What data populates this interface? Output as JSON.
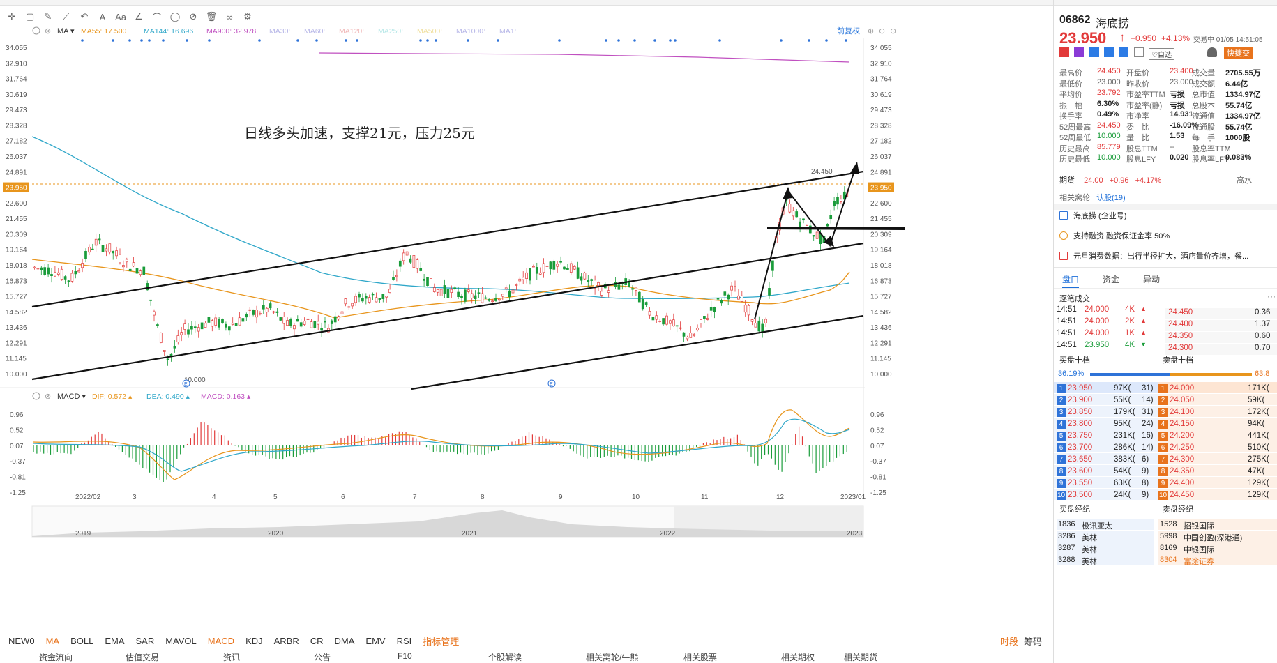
{
  "toolbar": {
    "icons": [
      "crosshair-icon",
      "rect-icon",
      "brush-icon",
      "trend-icon",
      "back-icon",
      "text-icon",
      "font-icon",
      "angle-icon",
      "arc-icon",
      "circle-icon",
      "ban-icon",
      "trash-icon",
      "link-icon",
      "gear-icon"
    ]
  },
  "ma_legend": {
    "label": "MA",
    "items": [
      {
        "name": "MA55:",
        "value": "17.500",
        "color": "#e8951c"
      },
      {
        "name": "MA144:",
        "value": "16.696",
        "color": "#2fa7c9"
      },
      {
        "name": "MA900:",
        "value": "32.978",
        "color": "#c050c0"
      },
      {
        "name": "MA30:",
        "value": "",
        "color": "#b8b8e8"
      },
      {
        "name": "MA60:",
        "value": "",
        "color": "#b8b8e8"
      },
      {
        "name": "MA120:",
        "value": "",
        "color": "#f0b8b8"
      },
      {
        "name": "MA250:",
        "value": "",
        "color": "#b8e8e8"
      },
      {
        "name": "MA500:",
        "value": "",
        "color": "#f0e0a0"
      },
      {
        "name": "MA1000:",
        "value": "",
        "color": "#b8b8e8"
      },
      {
        "name": "MA1:",
        "value": "",
        "color": "#b8b8e8"
      }
    ],
    "adjust": "前复权"
  },
  "macd_legend": {
    "label": "MACD",
    "items": [
      {
        "name": "DIF:",
        "value": "0.572",
        "color": "#e8951c"
      },
      {
        "name": "DEA:",
        "value": "0.490",
        "color": "#2fa7c9"
      },
      {
        "name": "MACD:",
        "value": "0.163",
        "color": "#c050c0"
      }
    ]
  },
  "annotation": "日线多头加速，支撑21元，压力25元",
  "high_label": "24.450",
  "low_label": "10.000",
  "event_marker": "E",
  "price_ticks": [
    "34.055",
    "32.910",
    "31.764",
    "30.619",
    "29.473",
    "28.328",
    "27.182",
    "26.037",
    "24.891",
    "23.950",
    "22.600",
    "21.455",
    "20.309",
    "19.164",
    "18.018",
    "16.873",
    "15.727",
    "14.582",
    "13.436",
    "12.291",
    "11.145",
    "10.000"
  ],
  "macd_ticks": [
    "0.96",
    "0.52",
    "0.07",
    "-0.37",
    "-0.81",
    "-1.25"
  ],
  "month_labels": [
    "2022/02",
    "3",
    "4",
    "5",
    "6",
    "7",
    "8",
    "9",
    "10",
    "11",
    "12",
    "2023/01"
  ],
  "overview_years": [
    "2019",
    "2020",
    "2021",
    "2022",
    "2023"
  ],
  "indicator_tabs": [
    "NEW0",
    "MA",
    "BOLL",
    "EMA",
    "SAR",
    "MAVOL",
    "MACD",
    "KDJ",
    "ARBR",
    "CR",
    "DMA",
    "EMV",
    "RSI",
    "指标管理"
  ],
  "indicator_active": [
    "MA",
    "MACD",
    "指标管理"
  ],
  "indicator_right": [
    "时段",
    "筹码"
  ],
  "bottom_bar": [
    "资金流向",
    "估值交易",
    "资讯",
    "公告",
    "F10",
    "个股解读",
    "相关窝轮/牛熊",
    "相关股票",
    "相关期权",
    "相关期货"
  ],
  "stock": {
    "code": "06862",
    "name": "海底捞",
    "price": "23.950",
    "arrow": "↑",
    "change": "+0.950",
    "pct": "+4.13%",
    "status": "交易中 01/05 14:51:05",
    "add_watch": "自选",
    "quick_trade": "快捷交"
  },
  "stats": [
    [
      {
        "k": "最高价",
        "v": "24.450",
        "c": "red"
      },
      {
        "k": "开盘价",
        "v": "23.400",
        "c": "red"
      },
      {
        "k": "成交量",
        "v": "2705.55万",
        "c": "b"
      }
    ],
    [
      {
        "k": "最低价",
        "v": "23.000",
        "c": "grey"
      },
      {
        "k": "昨收价",
        "v": "23.000",
        "c": "grey"
      },
      {
        "k": "成交额",
        "v": "6.44亿",
        "c": "b"
      }
    ],
    [
      {
        "k": "平均价",
        "v": "23.792",
        "c": "red"
      },
      {
        "k": "市盈率TTM",
        "v": "亏损",
        "c": "b"
      },
      {
        "k": "总市值",
        "v": "1334.97亿",
        "c": "b"
      }
    ],
    [
      {
        "k": "振　幅",
        "v": "6.30%",
        "c": "b"
      },
      {
        "k": "市盈率(静)",
        "v": "亏损",
        "c": "b"
      },
      {
        "k": "总股本",
        "v": "55.74亿",
        "c": "b"
      }
    ],
    [
      {
        "k": "换手率",
        "v": "0.49%",
        "c": "b"
      },
      {
        "k": "市净率",
        "v": "14.931",
        "c": "b"
      },
      {
        "k": "流通值",
        "v": "1334.97亿",
        "c": "b"
      }
    ],
    [
      {
        "k": "52周最高",
        "v": "24.450",
        "c": "red"
      },
      {
        "k": "委　比",
        "v": "-16.09%",
        "c": "b"
      },
      {
        "k": "流通股",
        "v": "55.74亿",
        "c": "b"
      }
    ],
    [
      {
        "k": "52周最低",
        "v": "10.000",
        "c": "green"
      },
      {
        "k": "量　比",
        "v": "1.53",
        "c": "b"
      },
      {
        "k": "每　手",
        "v": "1000股",
        "c": "b"
      }
    ],
    [
      {
        "k": "历史最高",
        "v": "85.779",
        "c": "red"
      },
      {
        "k": "股息TTM",
        "v": "--",
        "c": "grey"
      },
      {
        "k": "股息率TTM",
        "v": "--",
        "c": "grey"
      }
    ],
    [
      {
        "k": "历史最低",
        "v": "10.000",
        "c": "green"
      },
      {
        "k": "股息LFY",
        "v": "0.020",
        "c": "b"
      },
      {
        "k": "股息率LFY",
        "v": "0.083%",
        "c": "b"
      }
    ]
  ],
  "futures": {
    "label": "期货",
    "price": "24.00",
    "change": "+0.96",
    "pct": "+4.17%",
    "extra": "高水"
  },
  "related": {
    "label": "相关窝轮",
    "link": "认股(19)"
  },
  "news": [
    {
      "icon": "building-icon",
      "text": "海底捞 (企业号)"
    },
    {
      "icon": "coin-icon",
      "text": "支持融资 融资保证金率 50%"
    },
    {
      "icon": "doc-icon",
      "text": "元旦消费数据：出行半径扩大，酒店量价齐增，餐..."
    }
  ],
  "tabs": [
    "盘口",
    "资金",
    "异动"
  ],
  "tick_title": "逐笔成交",
  "ticks": [
    {
      "time": "14:51",
      "price": "24.000",
      "vol": "4K",
      "dir": "up"
    },
    {
      "time": "14:51",
      "price": "24.000",
      "vol": "2K",
      "dir": "up"
    },
    {
      "time": "14:51",
      "price": "24.000",
      "vol": "1K",
      "dir": "up"
    },
    {
      "time": "14:51",
      "price": "23.950",
      "vol": "4K",
      "dir": "down"
    }
  ],
  "depth_side": [
    {
      "price": "24.450",
      "vol": "0.36"
    },
    {
      "price": "24.400",
      "vol": "1.37"
    },
    {
      "price": "24.350",
      "vol": "0.60"
    },
    {
      "price": "24.300",
      "vol": "0.70"
    }
  ],
  "orderbook_titles": [
    "买盘十档",
    "卖盘十档"
  ],
  "ratio": {
    "bid": "36.19%",
    "ask": "63.8"
  },
  "bids": [
    {
      "i": "1",
      "p": "23.950",
      "v": "97K(",
      "n": "31)"
    },
    {
      "i": "2",
      "p": "23.900",
      "v": "55K(",
      "n": "14)"
    },
    {
      "i": "3",
      "p": "23.850",
      "v": "179K(",
      "n": "31)"
    },
    {
      "i": "4",
      "p": "23.800",
      "v": "95K(",
      "n": "24)"
    },
    {
      "i": "5",
      "p": "23.750",
      "v": "231K(",
      "n": "16)"
    },
    {
      "i": "6",
      "p": "23.700",
      "v": "286K(",
      "n": "14)"
    },
    {
      "i": "7",
      "p": "23.650",
      "v": "383K(",
      "n": "6)"
    },
    {
      "i": "8",
      "p": "23.600",
      "v": "54K(",
      "n": "9)"
    },
    {
      "i": "9",
      "p": "23.550",
      "v": "63K(",
      "n": "8)"
    },
    {
      "i": "10",
      "p": "23.500",
      "v": "24K(",
      "n": "9)"
    }
  ],
  "asks": [
    {
      "i": "1",
      "p": "24.000",
      "v": "171K("
    },
    {
      "i": "2",
      "p": "24.050",
      "v": "59K("
    },
    {
      "i": "3",
      "p": "24.100",
      "v": "172K("
    },
    {
      "i": "4",
      "p": "24.150",
      "v": "94K("
    },
    {
      "i": "5",
      "p": "24.200",
      "v": "441K("
    },
    {
      "i": "6",
      "p": "24.250",
      "v": "510K("
    },
    {
      "i": "7",
      "p": "24.300",
      "v": "275K("
    },
    {
      "i": "8",
      "p": "24.350",
      "v": "47K("
    },
    {
      "i": "9",
      "p": "24.400",
      "v": "129K("
    },
    {
      "i": "10",
      "p": "24.450",
      "v": "129K("
    }
  ],
  "brokers_titles": [
    "买盘经纪",
    "卖盘经纪"
  ],
  "buy_brokers": [
    {
      "id": "1836",
      "name": "极讯亚太"
    },
    {
      "id": "3286",
      "name": "美林"
    },
    {
      "id": "3287",
      "name": "美林"
    },
    {
      "id": "3288",
      "name": "美林"
    }
  ],
  "sell_brokers": [
    {
      "id": "1528",
      "name": "招银国际"
    },
    {
      "id": "5998",
      "name": "中国创盈(深港通)"
    },
    {
      "id": "8169",
      "name": "中银国际"
    },
    {
      "id": "8304",
      "name": "富途证券"
    }
  ],
  "colors": {
    "up": "#e23a3a",
    "down": "#1a9c3a",
    "ma55": "#e8951c",
    "ma144": "#2fa7c9",
    "ma900": "#c050c0",
    "accent": "#1e6fd9"
  }
}
